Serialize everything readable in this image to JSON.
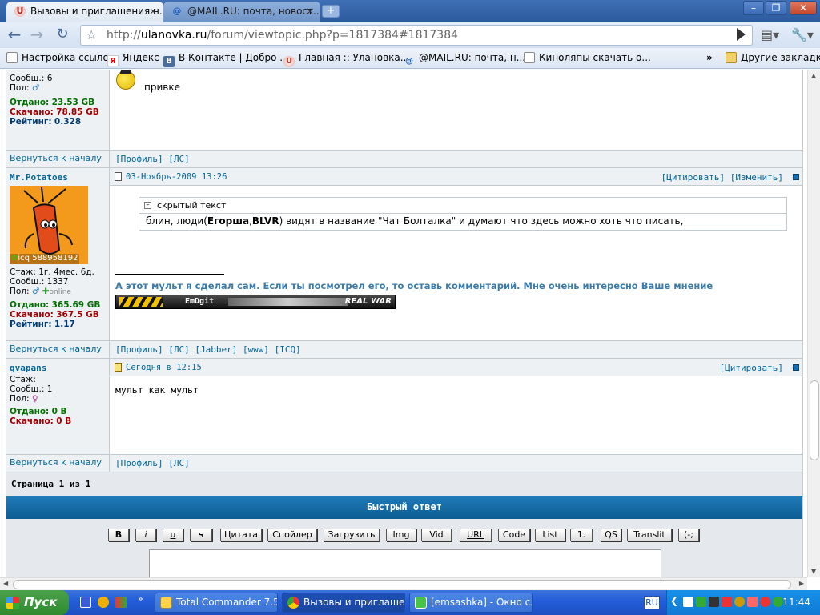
{
  "browser": {
    "tabs": [
      {
        "label": "Вызовы и приглашения н...",
        "icon": "ulanovka-favicon"
      },
      {
        "label": "@MAIL.RU: почта, новост...",
        "icon": "mailru-favicon"
      }
    ],
    "window_buttons": {
      "minimize": "–",
      "maximize": "❐",
      "close": "✕"
    },
    "url_prefix": "http://",
    "url_host": "ulanovka.ru",
    "url_path": "/forum/viewtopic.php?p=1817384#1817384",
    "bookmarks": [
      {
        "label": "Настройка ссылок",
        "icon": "page-icon"
      },
      {
        "label": "Яндекс",
        "icon": "yandex-icon"
      },
      {
        "label": "В Контакте | Добро ...",
        "icon": "vk-icon"
      },
      {
        "label": "Главная :: Улановка...",
        "icon": "ulanovka-icon"
      },
      {
        "label": "@MAIL.RU: почта, н...",
        "icon": "mailru-icon"
      },
      {
        "label": "Киноляпы скачать о...",
        "icon": "page-icon"
      }
    ],
    "bookmarks_more": "»",
    "other_bookmarks": "Другие закладки"
  },
  "posts": [
    {
      "id": "post-prev",
      "stats": {
        "messages_label": "Сообщ.:",
        "messages": "6",
        "sex_label": "Пол:",
        "upload_label": "Отдано:",
        "upload": "23.53 GB",
        "download_label": "Скачано:",
        "download": "78.85 GB",
        "rating_label": "Рейтинг:",
        "rating": "0.328"
      },
      "text": "привке",
      "back_link": "Вернуться к началу",
      "profile_links": "[Профиль] [ЛС]"
    },
    {
      "id": "post-potatoes",
      "username": "Mr.Potatoes",
      "icq": "588958192",
      "icq_label": "icq",
      "stats": {
        "stage": "Стаж: 1г. 4мес. 6д.",
        "messages": "Сообщ.: 1337",
        "sex_label": "Пол:",
        "online": "online",
        "upload_label": "Отдано:",
        "upload": "365.69 GB",
        "download_label": "Скачано:",
        "download": "367.5 GB",
        "rating_label": "Рейтинг:",
        "rating": "1.17"
      },
      "date": "03-Ноябрь-2009 13:26",
      "actions": "[Цитировать] [Изменить]",
      "spoiler_title": "скрытый текст",
      "spoiler_text_a": "блин, люди(",
      "spoiler_bold_1": "Егорша",
      "spoiler_comma": ",",
      "spoiler_bold_2": "BLVR",
      "spoiler_text_b": ") видят в название \"Чат Болталка\" и думают что здесь можно хоть что писать,",
      "signature": "А этот мульт я сделал сам. Если ты посмотрел его, то оставь комментарий. Мне очень интересно Ваше мнение",
      "banner_left": "EmDgit",
      "banner_right": "REAL WAR",
      "back_link": "Вернуться к началу",
      "profile_links": "[Профиль] [ЛС] [Jabber] [www] [ICQ]"
    },
    {
      "id": "post-qvapans",
      "username": "qvapans",
      "stats": {
        "stage": "Стаж:",
        "messages": "Сообщ.: 1",
        "sex_label": "Пол:",
        "upload_label": "Отдано:",
        "upload": "0 B",
        "download_label": "Скачано:",
        "download": "0 B"
      },
      "date": "Сегодня в 12:15",
      "actions": "[Цитировать]",
      "text": "мульт как мульт",
      "back_link": "Вернуться к началу",
      "profile_links": "[Профиль] [ЛС]"
    }
  ],
  "pagination": "Страница 1 из 1",
  "quick_reply": {
    "title": "Быстрый ответ",
    "buttons": [
      "B",
      "i",
      "u",
      "s",
      "Цитата",
      "Спойлер",
      "Загрузить",
      "Img",
      "Vid",
      "URL",
      "Code",
      "List",
      "1.",
      "QS",
      "Translit",
      "(-;"
    ]
  },
  "taskbar": {
    "start": "Пуск",
    "tasks": [
      {
        "label": "Total Commander 7.5...",
        "icon": "total-commander-icon"
      },
      {
        "label": "Вызовы и приглаше...",
        "icon": "chrome-icon"
      },
      {
        "label": "[emsashka] - Окно с...",
        "icon": "chat-window-icon"
      }
    ],
    "lang": "RU",
    "clock": "11:44"
  }
}
